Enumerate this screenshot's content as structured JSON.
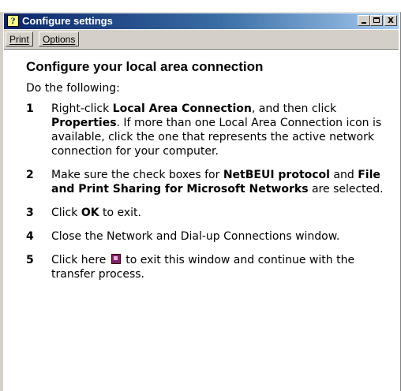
{
  "window": {
    "title": "Configure settings"
  },
  "title_buttons": {
    "minimize": "_",
    "maximize": "□",
    "close": "x"
  },
  "menu": {
    "print": "Print",
    "options": "Options"
  },
  "content": {
    "heading": "Configure your local area connection",
    "intro": "Do the following:",
    "steps": [
      {
        "num": "1",
        "pre": "Right-click ",
        "b1": "Local Area Connection",
        "mid": ", and then click ",
        "b2": "Properties",
        "post": ".  If more than one Local Area Connection icon is available, click the one that represents the active network connection for your computer."
      },
      {
        "num": "2",
        "pre": "Make sure the check boxes for ",
        "b1": "NetBEUI protocol",
        "mid": " and ",
        "b2": "File and Print Sharing for Microsoft Networks",
        "post": " are selected."
      },
      {
        "num": "3",
        "pre": "Click ",
        "b1": "OK",
        "post": " to exit."
      },
      {
        "num": "4",
        "text": "Close the Network and Dial-up Connections window."
      },
      {
        "num": "5",
        "pre": "Click here ",
        "post": " to exit this window and continue with the transfer process."
      }
    ]
  },
  "icons": {
    "title": "help-icon",
    "exit": "exit-icon"
  }
}
